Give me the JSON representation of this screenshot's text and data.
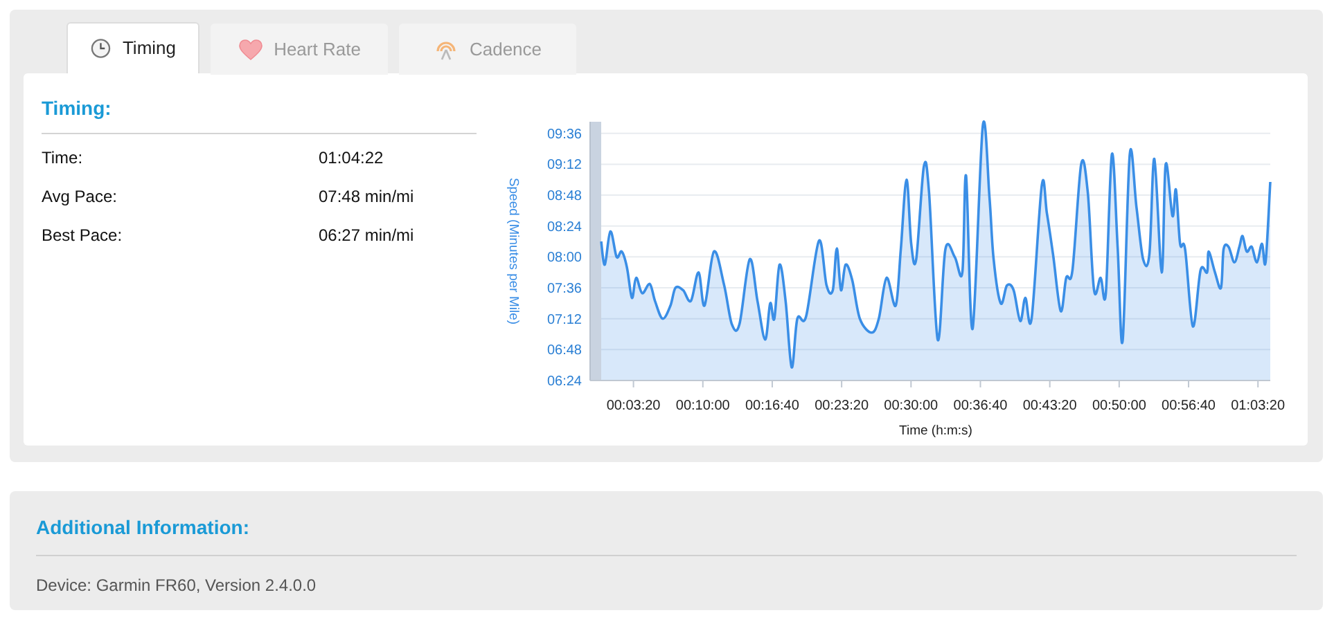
{
  "tabs": [
    {
      "label": "Timing",
      "selected": true
    },
    {
      "label": "Heart Rate",
      "selected": false
    },
    {
      "label": "Cadence",
      "selected": false
    }
  ],
  "timing": {
    "title": "Timing:",
    "rows": [
      {
        "label": "Time:",
        "value": "01:04:22"
      },
      {
        "label": "Avg Pace:",
        "value": "07:48 min/mi"
      },
      {
        "label": "Best Pace:",
        "value": "06:27 min/mi"
      }
    ],
    "chart_data": {
      "type": "area",
      "xlabel": "Time (h:m:s)",
      "ylabel": "Speed (Minutes per Mile)",
      "xlim": [
        14,
        3871
      ],
      "ylim": [
        6.4,
        9.75
      ],
      "grid": true,
      "xticks": [
        {
          "value": 200,
          "label": "00:03:20"
        },
        {
          "value": 600,
          "label": "00:10:00"
        },
        {
          "value": 1000,
          "label": "00:16:40"
        },
        {
          "value": 1400,
          "label": "00:23:20"
        },
        {
          "value": 1800,
          "label": "00:30:00"
        },
        {
          "value": 2200,
          "label": "00:36:40"
        },
        {
          "value": 2600,
          "label": "00:43:20"
        },
        {
          "value": 3000,
          "label": "00:50:00"
        },
        {
          "value": 3400,
          "label": "00:56:40"
        },
        {
          "value": 3800,
          "label": "01:03:20"
        }
      ],
      "yticks": [
        {
          "value": 6.4,
          "label": "06:24"
        },
        {
          "value": 6.8,
          "label": "06:48"
        },
        {
          "value": 7.2,
          "label": "07:12"
        },
        {
          "value": 7.6,
          "label": "07:36"
        },
        {
          "value": 8.0,
          "label": "08:00"
        },
        {
          "value": 8.4,
          "label": "08:24"
        },
        {
          "value": 8.8,
          "label": "08:48"
        },
        {
          "value": 9.2,
          "label": "09:12"
        },
        {
          "value": 9.6,
          "label": "09:36"
        }
      ],
      "x": [
        14,
        35,
        67,
        103,
        132,
        162,
        191,
        215,
        250,
        294,
        324,
        368,
        413,
        442,
        486,
        531,
        575,
        610,
        664,
        723,
        767,
        811,
        870,
        915,
        959,
        988,
        1012,
        1042,
        1077,
        1112,
        1145,
        1195,
        1269,
        1313,
        1349,
        1372,
        1396,
        1423,
        1461,
        1505,
        1573,
        1614,
        1659,
        1712,
        1741,
        1774,
        1801,
        1830,
        1874,
        1904,
        1954,
        1998,
        2052,
        2096,
        2117,
        2155,
        2214,
        2252,
        2276,
        2317,
        2353,
        2391,
        2430,
        2459,
        2495,
        2554,
        2583,
        2619,
        2663,
        2695,
        2731,
        2781,
        2819,
        2855,
        2893,
        2923,
        2958,
        2991,
        3020,
        3061,
        3100,
        3138,
        3174,
        3203,
        3245,
        3268,
        3307,
        3327,
        3351,
        3380,
        3425,
        3469,
        3507,
        3516,
        3552,
        3587,
        3602,
        3631,
        3664,
        3693,
        3711,
        3735,
        3764,
        3794,
        3823,
        3844,
        3871
      ],
      "series": [
        {
          "color": "#3a8ee6",
          "values": [
            8.2,
            7.9,
            8.33,
            8.0,
            8.07,
            7.87,
            7.47,
            7.73,
            7.53,
            7.65,
            7.43,
            7.2,
            7.37,
            7.6,
            7.57,
            7.43,
            7.8,
            7.37,
            8.07,
            7.63,
            7.13,
            7.13,
            7.97,
            7.43,
            6.93,
            7.4,
            7.2,
            7.9,
            7.43,
            6.57,
            7.2,
            7.23,
            8.21,
            7.63,
            7.57,
            8.11,
            7.57,
            7.9,
            7.7,
            7.2,
            7.02,
            7.2,
            7.73,
            7.37,
            8.1,
            9.0,
            8.17,
            7.97,
            9.17,
            8.83,
            6.93,
            8.1,
            8.0,
            7.8,
            9.05,
            7.07,
            9.7,
            8.77,
            7.97,
            7.4,
            7.63,
            7.57,
            7.17,
            7.47,
            7.2,
            8.93,
            8.57,
            8.03,
            7.3,
            7.73,
            7.83,
            9.2,
            8.83,
            7.57,
            7.73,
            7.53,
            9.33,
            8.13,
            6.91,
            9.33,
            8.63,
            7.97,
            8.03,
            9.27,
            7.8,
            9.2,
            8.53,
            8.87,
            8.17,
            8.1,
            7.1,
            7.83,
            7.8,
            8.07,
            7.8,
            7.6,
            8.1,
            8.13,
            7.93,
            8.13,
            8.27,
            8.07,
            8.13,
            7.93,
            8.17,
            7.93,
            8.97
          ]
        }
      ]
    }
  },
  "additional": {
    "title": "Additional Information:",
    "text": "Device: Garmin FR60, Version 2.4.0.0"
  }
}
